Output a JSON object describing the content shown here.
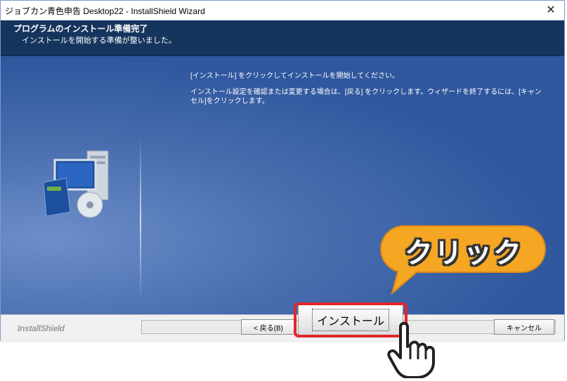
{
  "window": {
    "title": "ジョブカン青色申告 Desktop22 - InstallShield Wizard",
    "close_glyph": "✕"
  },
  "header": {
    "title": "プログラムのインストール準備完了",
    "subtitle": "インストールを開始する準備が整いました。"
  },
  "content": {
    "paragraph1": "[インストール] をクリックしてインストールを開始してください。",
    "paragraph2": "インストール設定を確認または変更する場合は、[戻る] をクリックします。ウィザードを終了するには、[キャンセル]をクリックします。"
  },
  "footer": {
    "brand": "InstallShield",
    "back_label": "< 戻る(B)",
    "install_label": "インストール",
    "cancel_label": "キャンセル"
  },
  "annotation": {
    "callout_text": "クリック",
    "callout_color": "#f5a623",
    "highlight_color": "#e4262a"
  },
  "icons": [
    "computer-cd-icon",
    "pointing-hand-icon"
  ]
}
